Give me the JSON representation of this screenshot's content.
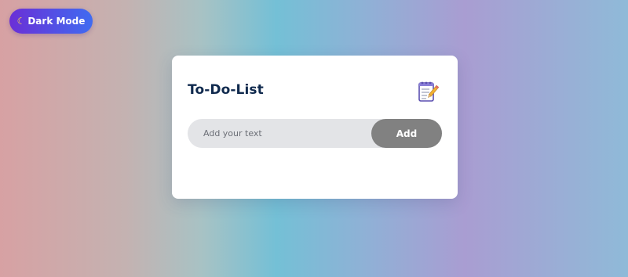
{
  "theme_toggle": {
    "icon": "moon-icon",
    "label": "Dark Mode",
    "gradient": [
      "#6b2fd6",
      "#3f6bf1"
    ]
  },
  "todo": {
    "title": "To-Do-List",
    "title_icon": "notepad-icon",
    "input": {
      "placeholder": "Add your text",
      "value": ""
    },
    "add_button_label": "Add",
    "tasks": []
  },
  "colors": {
    "title": "#102a4e",
    "input_background": "#e3e4e7",
    "add_button": "#818181",
    "card": "#ffffff"
  }
}
